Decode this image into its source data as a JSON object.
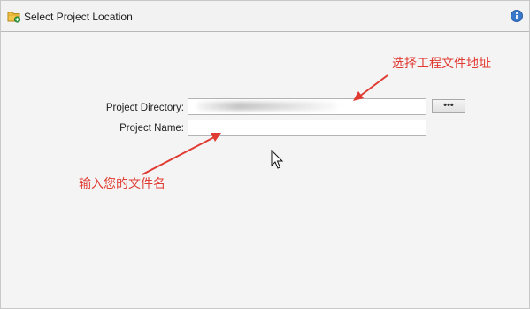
{
  "header": {
    "title": "Select Project Location",
    "icon": "folder-add-icon",
    "help_icon": "info-icon"
  },
  "form": {
    "directory_label": "Project Directory:",
    "directory_value": "",
    "browse_label": "•••",
    "name_label": "Project Name:",
    "name_value": ""
  },
  "annotations": {
    "directory_hint": "选择工程文件地址",
    "name_hint": "输入您的文件名",
    "color": "#e03b32"
  },
  "colors": {
    "background": "#f4f4f4",
    "header_border": "#b9b9b9",
    "info_blue": "#3a78c9"
  }
}
